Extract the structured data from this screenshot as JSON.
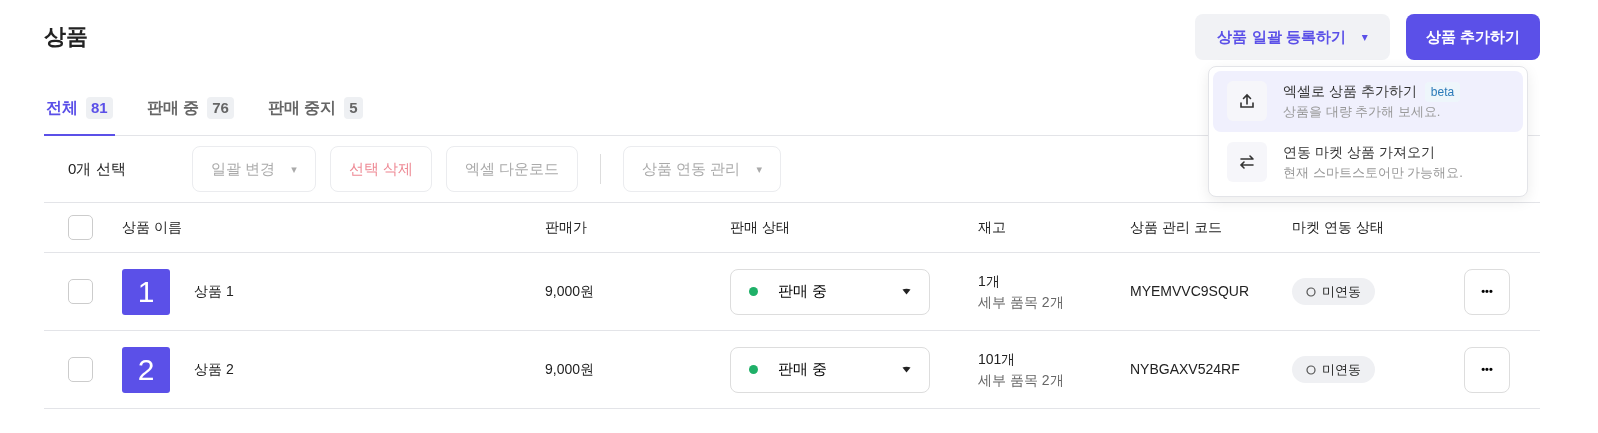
{
  "header": {
    "title": "상품",
    "bulk_button": {
      "label": "상품 일괄 등록하기",
      "caret": "▾"
    },
    "add_button": "상품 추가하기"
  },
  "bulk_menu": [
    {
      "kind": "upload",
      "title": "엑셀로 상품 추가하기",
      "badge": "beta",
      "subtitle": "상품을 대량 추가해 보세요.",
      "selected": true
    },
    {
      "kind": "swap",
      "title": "연동 마켓 상품 가져오기",
      "subtitle": "현재 스마트스토어만 가능해요.",
      "selected": false
    }
  ],
  "tabs": [
    {
      "label": "전체",
      "count": "81",
      "selected": true
    },
    {
      "label": "판매 중",
      "count": "76",
      "selected": false
    },
    {
      "label": "판매 중지",
      "count": "5",
      "selected": false
    }
  ],
  "toolbar": {
    "selection": "0개 선택",
    "actions": [
      {
        "label": "일괄 변경",
        "kind": "dropdown",
        "caret": "▾"
      },
      {
        "label": "선택 삭제",
        "kind": "danger"
      },
      {
        "label": "엑셀 다운로드",
        "kind": "plain"
      },
      {
        "kind": "divider"
      },
      {
        "label": "상품 연동 관리",
        "kind": "dropdown",
        "caret": "▾"
      }
    ]
  },
  "table": {
    "select_all_checked": false,
    "columns": [
      "상품 이름",
      "판매가",
      "판매 상태",
      "재고",
      "상품 관리 코드",
      "마켓 연동 상태"
    ],
    "rows": [
      {
        "checked": false,
        "thumb": "1",
        "name": "상품 1",
        "price": "9,000원",
        "status": {
          "label": "판매 중",
          "color": "#1fb068"
        },
        "stock": "1개",
        "variants": "세부 품목 2개",
        "code": "MYEMVVC9SQUR",
        "market": "미연동",
        "more": "•••"
      },
      {
        "checked": false,
        "thumb": "2",
        "name": "상품 2",
        "price": "9,000원",
        "status": {
          "label": "판매 중",
          "color": "#1fb068"
        },
        "stock": "101개",
        "variants": "세부 품목 2개",
        "code": "NYBGAXV524RF",
        "market": "미연동",
        "more": "•••"
      }
    ]
  }
}
